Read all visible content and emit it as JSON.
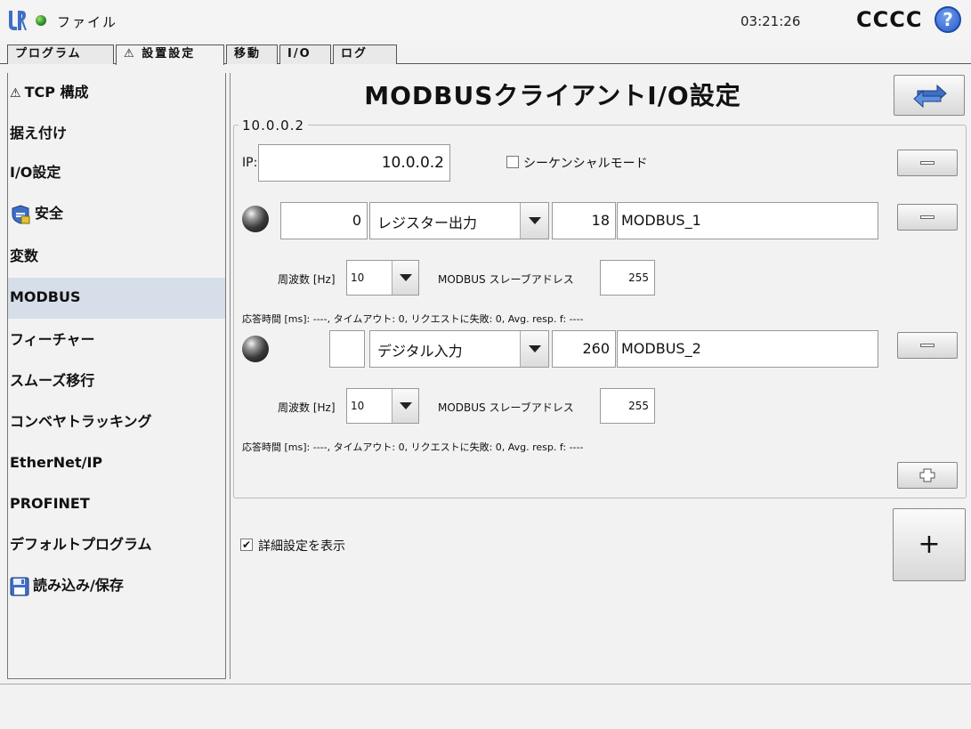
{
  "header": {
    "file_menu": "ファイル",
    "clock": "03:21:26",
    "robot_name": "CCCC",
    "help_glyph": "?",
    "status_color": "#2c8a1e"
  },
  "tabs": [
    {
      "label": "プログラム",
      "active": false
    },
    {
      "label": "設置設定",
      "active": true,
      "warning": true
    },
    {
      "label": "移動",
      "active": false
    },
    {
      "label": "I/O",
      "active": false
    },
    {
      "label": "ログ",
      "active": false
    }
  ],
  "warning_glyph": "⚠",
  "sidebar": {
    "items": [
      {
        "label": "TCP 構成",
        "icon": "warning-icon"
      },
      {
        "label": "据え付け"
      },
      {
        "label": "I/O設定"
      },
      {
        "label": "安全",
        "icon": "safety-shield-icon"
      },
      {
        "label": "変数"
      },
      {
        "label": "MODBUS",
        "active": true
      },
      {
        "label": "フィーチャー"
      },
      {
        "label": "スムーズ移行"
      },
      {
        "label": "コンベヤトラッキング"
      },
      {
        "label": "EtherNet/IP"
      },
      {
        "label": "PROFINET"
      },
      {
        "label": "デフォルトプログラム"
      },
      {
        "label": "読み込み/保存",
        "icon": "floppy-disk-icon"
      }
    ]
  },
  "main": {
    "title": "MODBUSクライアントI/O設定",
    "group": {
      "title": "10.0.0.2",
      "ip_label": "IP:",
      "ip_value": "10.0.0.2",
      "sequential_mode_label": "シーケンシャルモード",
      "sequential_mode_checked": false,
      "signals": [
        {
          "address": "0",
          "type": "レジスター出力",
          "value": "18",
          "name": "MODBUS_1",
          "freq_label": "周波数 [Hz]",
          "freq": "10",
          "slave_label": "MODBUS スレーブアドレス",
          "slave_address": "255",
          "status": "応答時間 [ms]: ----, タイムアウト: 0, リクエストに失敗: 0, Avg. resp. f: ----"
        },
        {
          "address": "",
          "type": "デジタル入力",
          "value": "260",
          "name": "MODBUS_2",
          "freq_label": "周波数 [Hz]",
          "freq": "10",
          "slave_label": "MODBUS スレーブアドレス",
          "slave_address": "255",
          "status": "応答時間 [ms]: ----, タイムアウト: 0, リクエストに失敗: 0, Avg. resp. f: ----"
        }
      ]
    },
    "show_advanced_label": "詳細設定を表示",
    "show_advanced_checked": true,
    "check_glyph": "✔",
    "add_unit_label": "+"
  }
}
